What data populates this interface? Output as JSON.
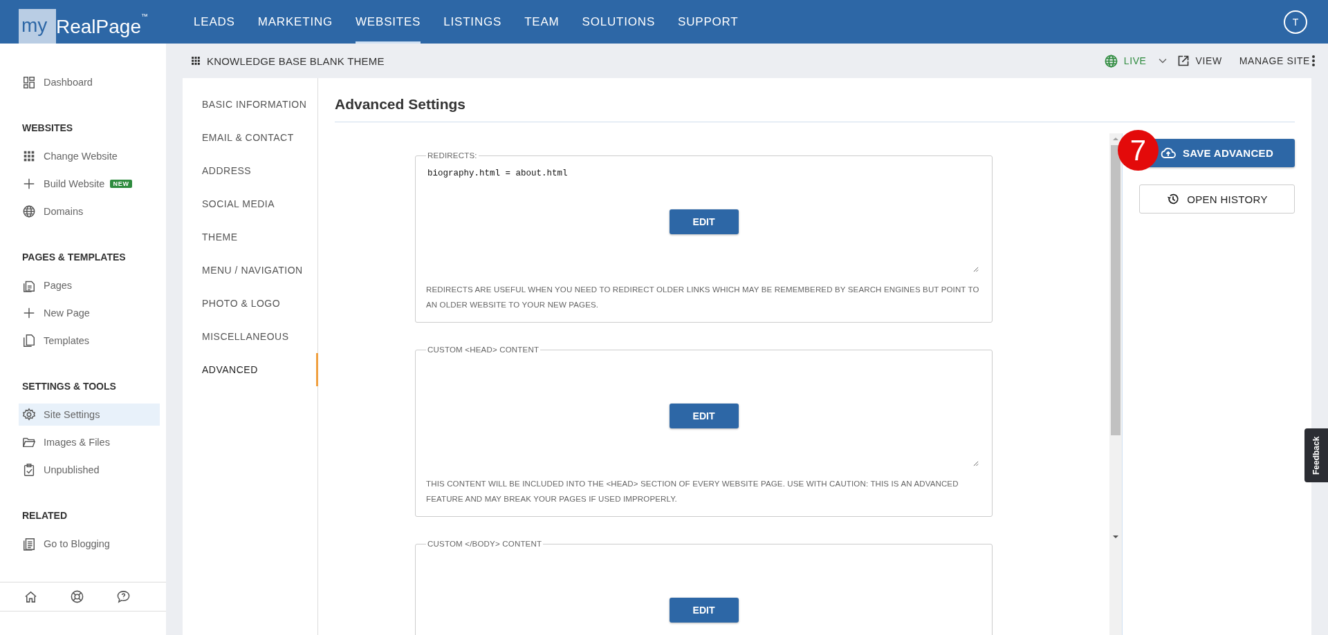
{
  "top_nav": {
    "logo": {
      "prefix": "my",
      "name": "RealPage",
      "mark": "™"
    },
    "items": [
      {
        "label": "LEADS",
        "selected": false
      },
      {
        "label": "MARKETING",
        "selected": false
      },
      {
        "label": "WEBSITES",
        "selected": true
      },
      {
        "label": "LISTINGS",
        "selected": false
      },
      {
        "label": "TEAM",
        "selected": false
      },
      {
        "label": "SOLUTIONS",
        "selected": false
      },
      {
        "label": "SUPPORT",
        "selected": false
      }
    ],
    "avatar": "T"
  },
  "sidebar": {
    "sections": [
      {
        "items": [
          {
            "label": "Dashboard",
            "kind": "dashboard",
            "selected": false
          }
        ]
      },
      {
        "heading": "WEBSITES",
        "items": [
          {
            "label": "Change Website",
            "kind": "grid",
            "selected": false
          },
          {
            "label": "Build Website",
            "kind": "plus",
            "badge": "NEW",
            "selected": false
          },
          {
            "label": "Domains",
            "kind": "globe",
            "selected": false
          }
        ]
      },
      {
        "heading": "PAGES & TEMPLATES",
        "items": [
          {
            "label": "Pages",
            "kind": "pages",
            "selected": false
          },
          {
            "label": "New Page",
            "kind": "plus",
            "selected": false
          },
          {
            "label": "Templates",
            "kind": "copy",
            "selected": false
          }
        ]
      },
      {
        "heading": "SETTINGS & TOOLS",
        "items": [
          {
            "label": "Site Settings",
            "kind": "gear",
            "selected": true
          },
          {
            "label": "Images & Files",
            "kind": "folder",
            "selected": false
          },
          {
            "label": "Unpublished",
            "kind": "clipboard",
            "selected": false
          }
        ]
      },
      {
        "heading": "RELATED",
        "items": [
          {
            "label": "Go to Blogging",
            "kind": "list",
            "selected": false
          }
        ]
      }
    ]
  },
  "toolbar": {
    "site_name": "KNOWLEDGE BASE BLANK THEME",
    "status": "LIVE",
    "view": "VIEW",
    "manage": "MANAGE SITE"
  },
  "settings_nav": [
    {
      "label": "BASIC INFORMATION",
      "selected": false
    },
    {
      "label": "EMAIL & CONTACT",
      "selected": false
    },
    {
      "label": "ADDRESS",
      "selected": false
    },
    {
      "label": "SOCIAL MEDIA",
      "selected": false
    },
    {
      "label": "THEME",
      "selected": false
    },
    {
      "label": "MENU / NAVIGATION",
      "selected": false
    },
    {
      "label": "PHOTO & LOGO",
      "selected": false
    },
    {
      "label": "MISCELLANEOUS",
      "selected": false
    },
    {
      "label": "ADVANCED",
      "selected": true
    }
  ],
  "content": {
    "title": "Advanced Settings",
    "sections": [
      {
        "legend": "REDIRECTS:",
        "value": "biography.html = about.html",
        "button": "EDIT",
        "help": "REDIRECTS ARE USEFUL WHEN YOU NEED TO REDIRECT OLDER LINKS WHICH MAY BE REMEMBERED BY SEARCH ENGINES BUT POINT TO AN OLDER WEBSITE TO YOUR NEW PAGES."
      },
      {
        "legend": "CUSTOM <HEAD> CONTENT",
        "button": "EDIT",
        "help": "THIS CONTENT WILL BE INCLUDED INTO THE <HEAD> SECTION OF EVERY WEBSITE PAGE. USE WITH CAUTION: THIS IS AN ADVANCED FEATURE AND MAY BREAK YOUR PAGES IF USED IMPROPERLY."
      },
      {
        "legend": "CUSTOM </BODY> CONTENT",
        "button": "EDIT"
      }
    ]
  },
  "actions": {
    "save": "SAVE ADVANCED",
    "history": "OPEN HISTORY"
  },
  "annotation_badge": "7",
  "feedback_tab": "Feedback"
}
